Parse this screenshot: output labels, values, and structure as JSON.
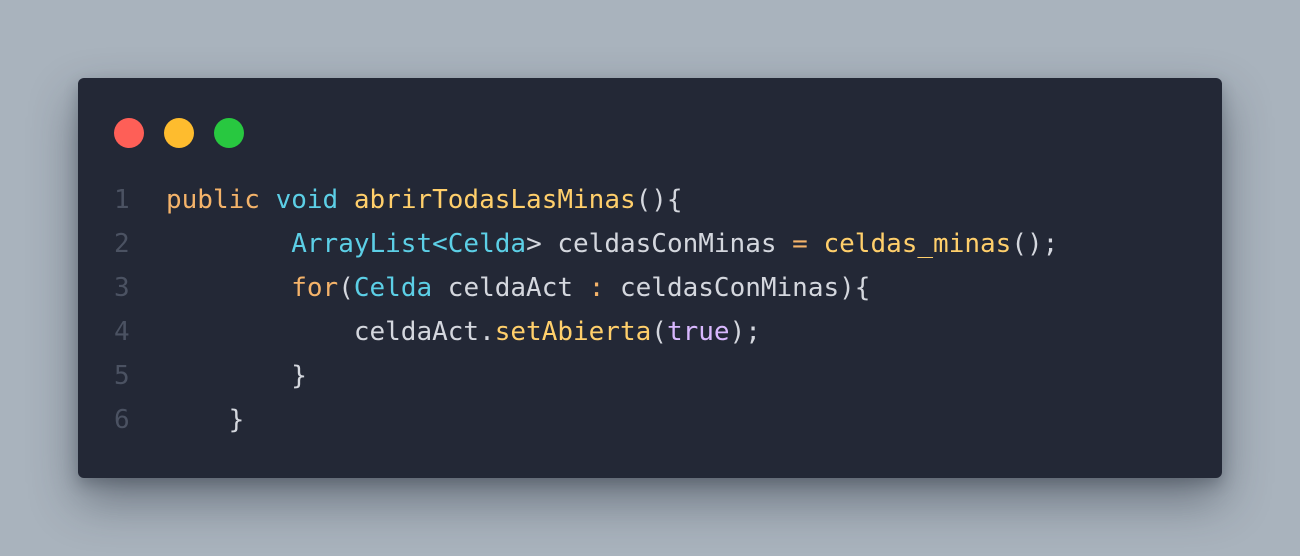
{
  "window": {
    "controls": [
      "close",
      "minimize",
      "maximize"
    ]
  },
  "code": {
    "lines": [
      {
        "number": "1",
        "tokens": [
          {
            "text": "public",
            "kind": "kw"
          },
          {
            "text": " ",
            "kind": "pl"
          },
          {
            "text": "void",
            "kind": "ty"
          },
          {
            "text": " ",
            "kind": "pl"
          },
          {
            "text": "abrirTodasLasMinas",
            "kind": "fn"
          },
          {
            "text": "(){",
            "kind": "pu"
          }
        ]
      },
      {
        "number": "2",
        "tokens": [
          {
            "text": "        ",
            "kind": "pl"
          },
          {
            "text": "ArrayList",
            "kind": "ty"
          },
          {
            "text": "<",
            "kind": "tg"
          },
          {
            "text": "Celda",
            "kind": "ty"
          },
          {
            "text": "> celdasConMinas ",
            "kind": "pl"
          },
          {
            "text": "=",
            "kind": "op"
          },
          {
            "text": " ",
            "kind": "pl"
          },
          {
            "text": "celdas_minas",
            "kind": "fn"
          },
          {
            "text": "();",
            "kind": "pu"
          }
        ]
      },
      {
        "number": "3",
        "tokens": [
          {
            "text": "        ",
            "kind": "pl"
          },
          {
            "text": "for",
            "kind": "kw"
          },
          {
            "text": "(",
            "kind": "pu"
          },
          {
            "text": "Celda",
            "kind": "ty"
          },
          {
            "text": " celdaAct ",
            "kind": "pl"
          },
          {
            "text": ":",
            "kind": "op"
          },
          {
            "text": " celdasConMinas){",
            "kind": "pl"
          }
        ]
      },
      {
        "number": "4",
        "tokens": [
          {
            "text": "            ",
            "kind": "pl"
          },
          {
            "text": "celdaAct.",
            "kind": "pl"
          },
          {
            "text": "setAbierta",
            "kind": "fn"
          },
          {
            "text": "(",
            "kind": "pu"
          },
          {
            "text": "true",
            "kind": "bool"
          },
          {
            "text": ");",
            "kind": "pu"
          }
        ]
      },
      {
        "number": "5",
        "tokens": [
          {
            "text": "        ",
            "kind": "pl"
          },
          {
            "text": "}",
            "kind": "pu"
          }
        ]
      },
      {
        "number": "6",
        "tokens": [
          {
            "text": "    ",
            "kind": "pl"
          },
          {
            "text": "}",
            "kind": "pu"
          }
        ]
      }
    ]
  },
  "colors": {
    "background": "#a9b3bd",
    "editor": "#232836",
    "close": "#fe5f57",
    "minimize": "#febc2e",
    "maximize": "#28c840",
    "keyword": "#f4b36a",
    "type": "#5ccfe6",
    "function": "#ffcf6b",
    "boolean": "#d9b8ff",
    "plain": "#d4d7de",
    "line_number": "#4b5262"
  }
}
